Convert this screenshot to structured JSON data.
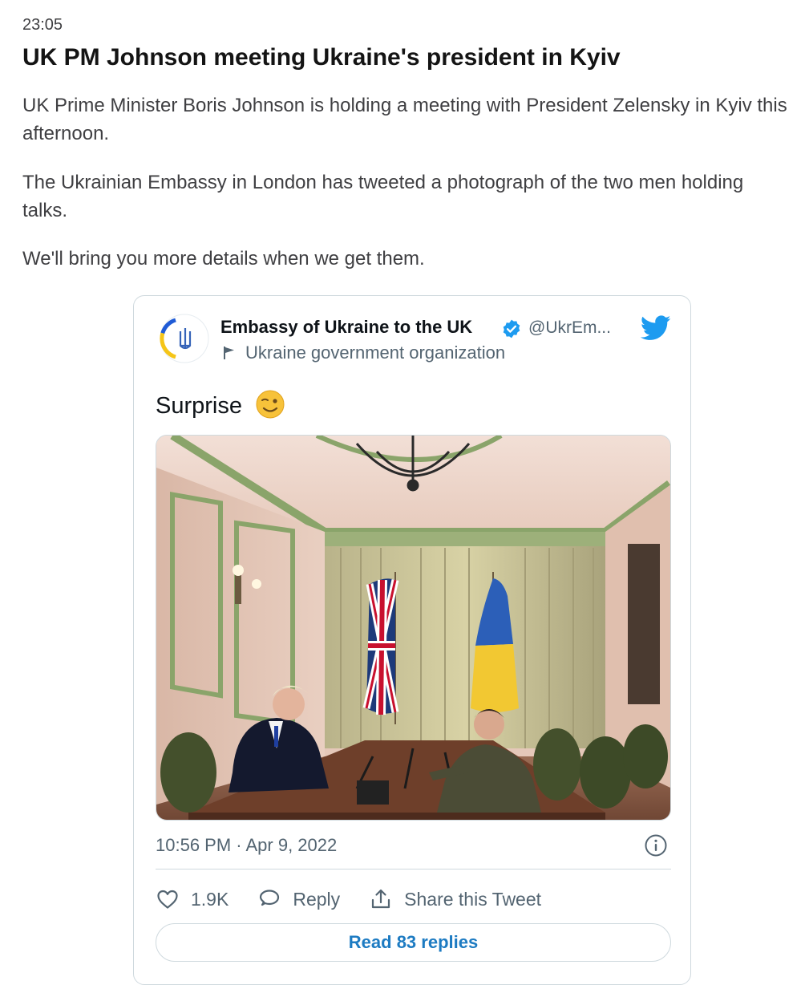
{
  "article": {
    "time": "23:05",
    "headline": "UK PM Johnson meeting Ukraine's president in Kyiv",
    "paragraphs": [
      "UK Prime Minister Boris Johnson is holding a meeting with President Zelensky in Kyiv this afternoon.",
      "The Ukrainian Embassy in London has tweeted a photograph of the two men holding talks.",
      "We'll bring you more details when we get them."
    ]
  },
  "tweet": {
    "account_name": "Embassy of Ukraine to the UK",
    "handle": "@UkrEm...",
    "org_label": "Ukraine government organization",
    "text": "Surprise",
    "emoji": "winking-face-emoji",
    "timestamp": "10:56 PM · Apr 9, 2022",
    "likes": "1.9K",
    "reply_label": "Reply",
    "share_label": "Share this Tweet",
    "read_replies_label": "Read 83 replies",
    "icons": [
      "ukraine-embassy-logo",
      "verified-badge-icon",
      "twitter-bird-icon",
      "flag-icon",
      "info-icon",
      "heart-icon",
      "reply-icon",
      "share-icon"
    ],
    "colors": {
      "accent": "#1d9bf0",
      "link": "#1d7bc2",
      "muted": "#536471",
      "border": "#cfd9de"
    }
  }
}
